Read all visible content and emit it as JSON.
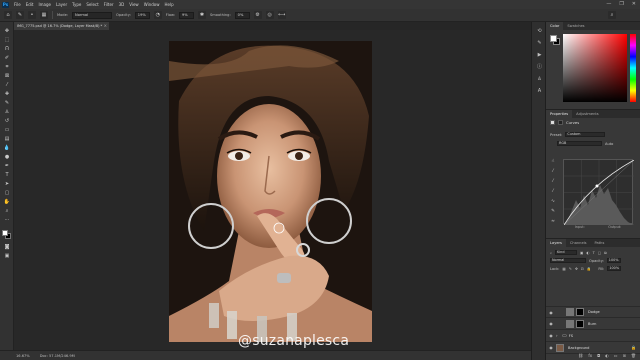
{
  "app": {
    "logo": "Ps",
    "menu": [
      "File",
      "Edit",
      "Image",
      "Layer",
      "Type",
      "Select",
      "Filter",
      "3D",
      "View",
      "Window",
      "Help"
    ],
    "window_controls": [
      "—",
      "❐",
      "✕"
    ]
  },
  "options_bar": {
    "mode_label": "Mode:",
    "mode_value": "Normal",
    "opacity_label": "Opacity:",
    "opacity_value": "19%",
    "flow_label": "Flow:",
    "flow_value": "9%",
    "smoothing_label": "Smoothing:",
    "smoothing_value": "0%"
  },
  "document": {
    "tab_title": "IMG_7775.psd @ 16.7% (Dodge, Layer Mask/8) *",
    "close_glyph": "×"
  },
  "canvas": {
    "watermark": "@suzanaplesca"
  },
  "status_bar": {
    "zoom": "16.67%",
    "doc_info": "Doc: 57.1M/246.9M"
  },
  "panels": {
    "color": {
      "tabs": [
        "Color",
        "Swatches"
      ]
    },
    "properties": {
      "tabs": [
        "Properties",
        "Adjustments"
      ],
      "type_label": "Curves",
      "preset_label": "Preset:",
      "preset_value": "Custom",
      "channel_value": "RGB",
      "auto_label": "Auto",
      "input_label": "Input:",
      "output_label": "Output:"
    },
    "layers": {
      "tabs": [
        "Layers",
        "Channels",
        "Paths"
      ],
      "kind_label": "Kind",
      "blend_value": "Normal",
      "opacity_label": "Opacity:",
      "opacity_value": "100%",
      "lock_label": "Lock:",
      "fill_label": "Fill:",
      "fill_value": "100%",
      "items": [
        {
          "name": "Dodge"
        },
        {
          "name": "Burn"
        },
        {
          "name": "FS"
        },
        {
          "name": "Background"
        }
      ]
    }
  },
  "colors": {
    "accent": "#2fa3f7",
    "panel_bg": "#383838",
    "app_bg": "#282828"
  }
}
